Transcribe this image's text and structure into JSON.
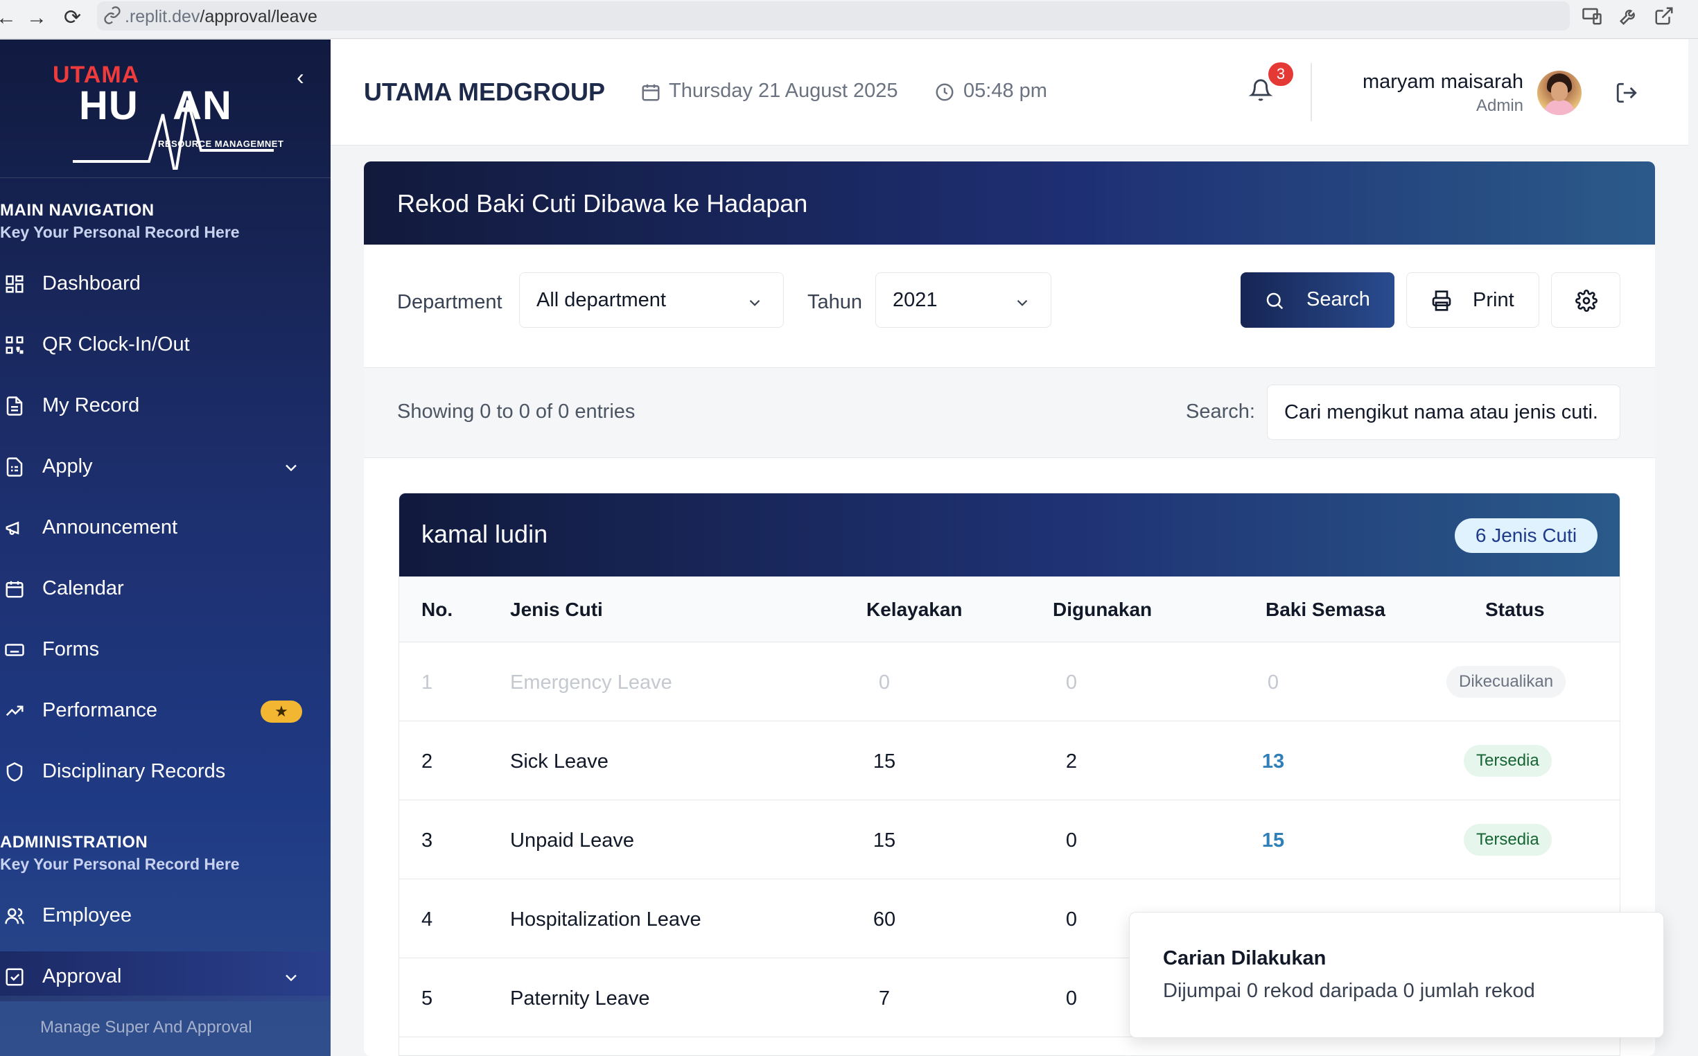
{
  "browser": {
    "url_dim": "",
    "url_prefix": ".replit.dev",
    "url_path": "/approval/leave"
  },
  "sidebar": {
    "brand_top": "UTAMA",
    "brand_main": "HUMAN",
    "brand_sub": "RESOURCE MANAGEMNET",
    "sections": [
      {
        "title": "MAIN NAVIGATION",
        "subtitle": "Key Your Personal Record Here"
      },
      {
        "title": "ADMINISTRATION",
        "subtitle": "Key Your Personal Record Here"
      }
    ],
    "items": [
      {
        "label": "Dashboard",
        "icon": "dashboard-icon"
      },
      {
        "label": "QR Clock-In/Out",
        "icon": "qr-icon"
      },
      {
        "label": "My Record",
        "icon": "document-icon"
      },
      {
        "label": "Apply",
        "icon": "form-icon"
      },
      {
        "label": "Announcement",
        "icon": "megaphone-icon"
      },
      {
        "label": "Calendar",
        "icon": "calendar-icon"
      },
      {
        "label": "Forms",
        "icon": "keyboard-icon"
      },
      {
        "label": "Performance",
        "icon": "trending-up-icon"
      },
      {
        "label": "Disciplinary Records",
        "icon": "shield-icon"
      },
      {
        "label": "Employee",
        "icon": "users-icon"
      },
      {
        "label": "Approval",
        "icon": "checkbox-icon"
      }
    ],
    "performance_badge": "★",
    "sub_item": "Manage Super And Approval"
  },
  "header": {
    "org": "UTAMA MEDGROUP",
    "date": "Thursday 21 August 2025",
    "time": "05:48 pm",
    "notifications": "3",
    "user_name": "maryam maisarah",
    "user_role": "Admin"
  },
  "page": {
    "title": "Rekod Baki Cuti Dibawa ke Hadapan",
    "filters": {
      "department_label": "Department",
      "department_value": "All department",
      "year_label": "Tahun",
      "year_value": "2021",
      "search_btn": "Search",
      "print_btn": "Print"
    },
    "entries": "Showing 0 to 0 of 0 entries",
    "search_label": "Search:",
    "search_placeholder": "Cari mengikut nama atau jenis cuti."
  },
  "employee": {
    "name": "kamal ludin",
    "badge": "6 Jenis Cuti",
    "columns": [
      "No.",
      "Jenis Cuti",
      "Kelayakan",
      "Digunakan",
      "Baki Semasa",
      "Status"
    ],
    "rows": [
      {
        "no": "1",
        "type": "Emergency Leave",
        "entitled": "0",
        "used": "0",
        "balance": "0",
        "status": "Dikecualikan"
      },
      {
        "no": "2",
        "type": "Sick Leave",
        "entitled": "15",
        "used": "2",
        "balance": "13",
        "status": "Tersedia"
      },
      {
        "no": "3",
        "type": "Unpaid Leave",
        "entitled": "15",
        "used": "0",
        "balance": "15",
        "status": "Tersedia"
      },
      {
        "no": "4",
        "type": "Hospitalization Leave",
        "entitled": "60",
        "used": "0",
        "balance": "",
        "status": ""
      },
      {
        "no": "5",
        "type": "Paternity Leave",
        "entitled": "7",
        "used": "0",
        "balance": "",
        "status": ""
      }
    ]
  },
  "toast": {
    "title": "Carian Dilakukan",
    "message": "Dijumpai 0 rekod daripada 0 jumlah rekod"
  },
  "colors": {
    "sidebar_top": "#111a3f",
    "sidebar_bottom": "#2b4a8c",
    "accent": "#2f7fb8",
    "notification": "#e53935",
    "status_ok_bg": "#e6f6ec"
  }
}
